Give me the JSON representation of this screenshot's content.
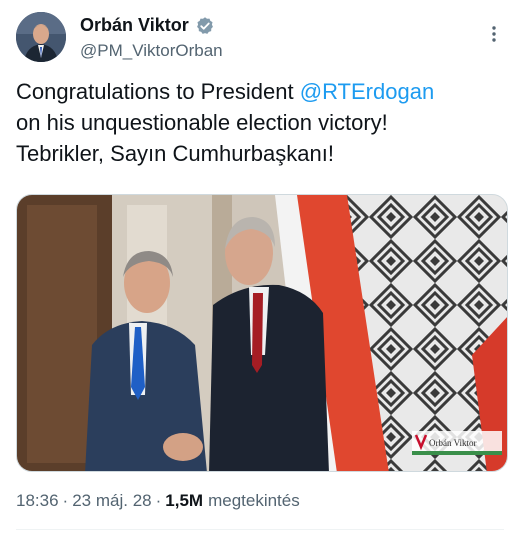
{
  "author": {
    "display_name": "Orbán Viktor",
    "handle": "@PM_ViktorOrban",
    "verified": true
  },
  "tweet": {
    "text_line1_prefix": "Congratulations to President ",
    "mention": "@RTErdogan",
    "text_line2": "on his unquestionable election victory!",
    "text_line3": "Tebrikler, Sayın Cumhurbaşkanı!"
  },
  "media": {
    "watermark": "Orbán Viktor"
  },
  "meta": {
    "time": "18:36",
    "date": "23 máj. 28",
    "views_count": "1,5M",
    "views_label": "megtekintés"
  },
  "colors": {
    "link": "#1d9bf0",
    "secondary_text": "#536471",
    "primary_text": "#0f1419"
  },
  "icons": [
    "verified-badge-icon",
    "more-options-icon"
  ]
}
